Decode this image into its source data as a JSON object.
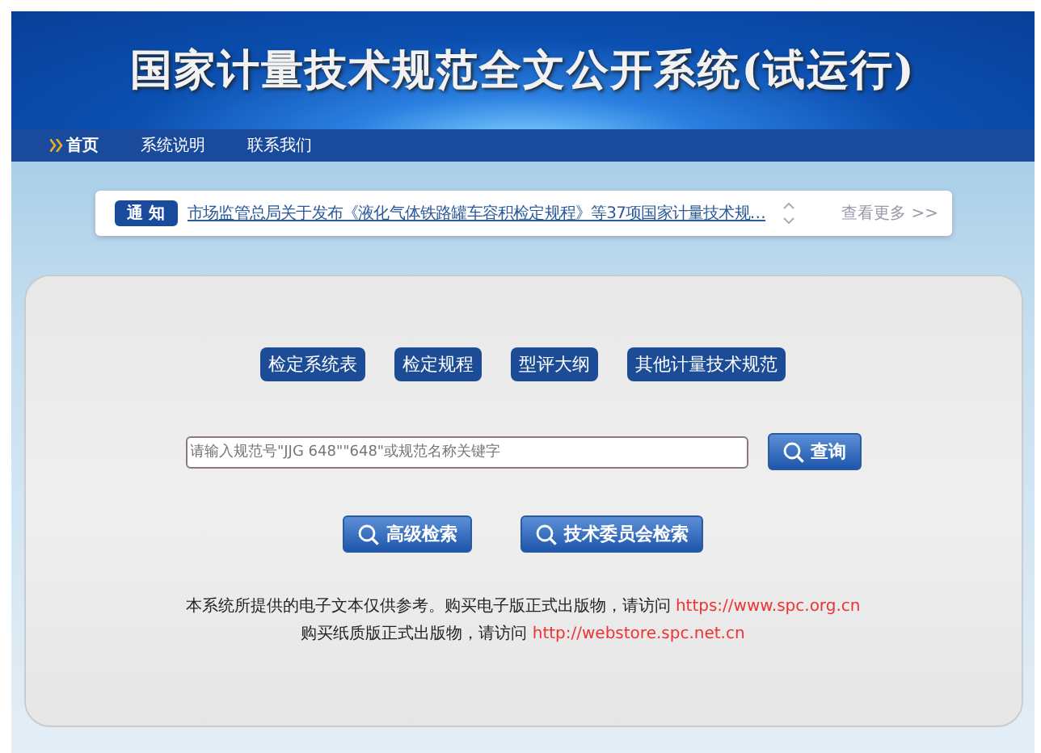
{
  "header": {
    "title": "国家计量技术规范全文公开系统(试运行)"
  },
  "nav": [
    {
      "label": "首页",
      "selected": true
    },
    {
      "label": "系统说明",
      "selected": false
    },
    {
      "label": "联系我们",
      "selected": false
    }
  ],
  "notice": {
    "badge": "通 知",
    "text": "市场监管总局关于发布《液化气体铁路罐车容积检定规程》等37项国家计量技术规…",
    "more": "查看更多 >>"
  },
  "categories": [
    "检定系统表",
    "检定规程",
    "型评大纲",
    "其他计量技术规范"
  ],
  "search": {
    "placeholder": "请输入规范号\"JJG 648\"\"648\"或规范名称关键字",
    "button": "查询"
  },
  "extra_buttons": [
    "高级检索",
    "技术委员会检索"
  ],
  "footer": [
    {
      "text": "本系统所提供的电子文本仅供参考。购买电子版正式出版物，请访问",
      "link": "https://www.spc.org.cn"
    },
    {
      "text": "购买纸质版正式出版物，请访问",
      "link": "http://webstore.spc.net.cn"
    }
  ]
}
